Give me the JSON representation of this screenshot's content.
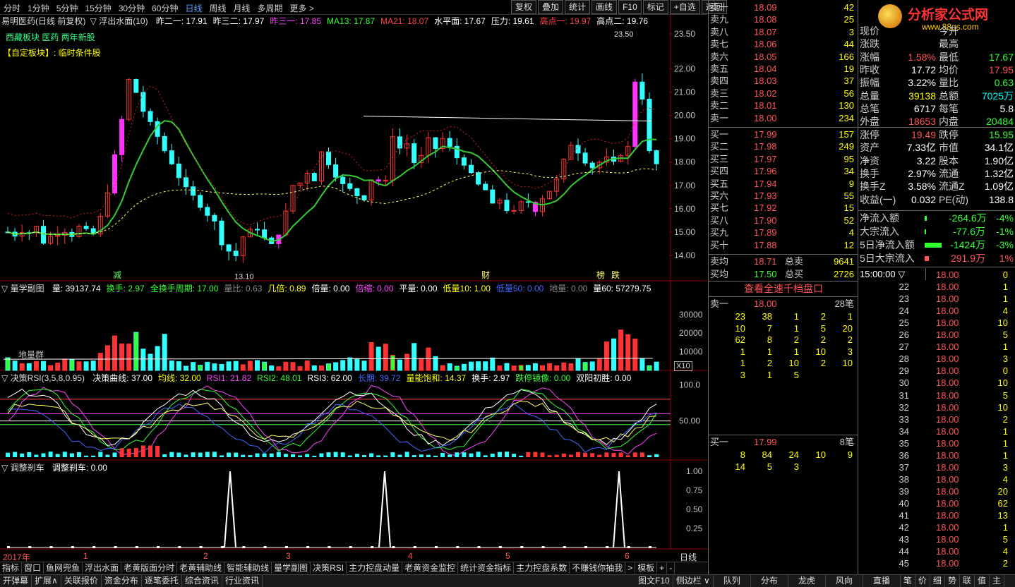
{
  "periods": [
    "分时",
    "1分钟",
    "5分钟",
    "15分钟",
    "30分钟",
    "60分钟",
    "日线",
    "周线",
    "月线",
    "多周期",
    "更多 >"
  ],
  "active_period": "日线",
  "toolbar": [
    "复权",
    "叠加",
    "统计",
    "画线",
    "F10",
    "标记",
    "+自选",
    "返回"
  ],
  "main_header": {
    "title": "易明医药(日线 前复权)",
    "indicator": "▽ 浮出水面(10)",
    "items": [
      {
        "text": "昨二一: 17.91",
        "color": "#ffffff"
      },
      {
        "text": "昨三二: 17.97",
        "color": "#ffffff"
      },
      {
        "text": "昨三一: 17.85",
        "color": "#ff44ff"
      },
      {
        "text": "MA13: 17.87",
        "color": "#33ff33"
      },
      {
        "text": "MA21: 18.07",
        "color": "#ff4444"
      },
      {
        "text": "水平面: 17.67",
        "color": "#ffffff"
      },
      {
        "text": "压力: 19.61",
        "color": "#ffffff"
      },
      {
        "text": "高点一: 19.97",
        "color": "#ff4444"
      },
      {
        "text": "高点二: 19.76",
        "color": "#ffffff"
      }
    ],
    "sector": "西藏板块  医药  两年新股",
    "custom": "【自定板块】: 临时条件股"
  },
  "price_axis": [
    "23.50",
    "22.00",
    "21.00",
    "20.00",
    "19.00",
    "18.00",
    "17.00",
    "16.00",
    "15.00",
    "14.00"
  ],
  "price_labels": {
    "high": "23.50",
    "low": "13.10"
  },
  "event_markers": [
    "减",
    "财",
    "榜",
    "跌"
  ],
  "volume_header": {
    "name": "▽ 量学副图",
    "items": [
      {
        "text": "量: 39137.74",
        "color": "#ffffff"
      },
      {
        "text": "换手: 2.97",
        "color": "#33ff33"
      },
      {
        "text": "全换手周期: 17.00",
        "color": "#33ff33"
      },
      {
        "text": "量比: 0.63",
        "color": "#888888"
      },
      {
        "text": "几倍: 0.89",
        "color": "#ffff00"
      },
      {
        "text": "倍量: 0.00",
        "color": "#ffffff"
      },
      {
        "text": "倍缩: 0.00",
        "color": "#ff44ff"
      },
      {
        "text": "平量: 0.00",
        "color": "#ffffff"
      },
      {
        "text": "低量10: 1.00",
        "color": "#ffff00"
      },
      {
        "text": "低量50: 0.00",
        "color": "#4466ff"
      },
      {
        "text": "地量: 0.00",
        "color": "#888888"
      },
      {
        "text": "量60: 57279.75",
        "color": "#ffffff"
      }
    ],
    "axis": [
      "30000",
      "20000",
      "10000"
    ],
    "tag": "地量群",
    "unit": "X10"
  },
  "rsi_header": {
    "name": "▽ 决策RSI(3,5,8,0.95)",
    "items": [
      {
        "text": "决策曲线: 37.00",
        "color": "#ffffff"
      },
      {
        "text": "均线: 32.00",
        "color": "#ffff00"
      },
      {
        "text": "RSI1: 21.82",
        "color": "#ff44ff"
      },
      {
        "text": "RSI2: 48.01",
        "color": "#33ff33"
      },
      {
        "text": "RSI3: 62.00",
        "color": "#ffffff"
      },
      {
        "text": "长期: 39.72",
        "color": "#4466ff"
      },
      {
        "text": "量能饱和: 14.37",
        "color": "#ffff00"
      },
      {
        "text": "换手: 2.97",
        "color": "#ffffff"
      },
      {
        "text": "跌停镜像: 0.00",
        "color": "#33ff33"
      },
      {
        "text": "双阳初胜: 0.00",
        "color": "#ffffff"
      }
    ],
    "axis": [
      "100.0",
      "50.00"
    ]
  },
  "adj_header": {
    "name": "▽ 调整刹车",
    "items": [
      {
        "text": "调整刹车: 0.00",
        "color": "#ffffff"
      }
    ],
    "axis": [
      "1.00",
      "0.75",
      "0.50",
      "0.25"
    ]
  },
  "date_axis": {
    "year": "2017年",
    "months": [
      "1",
      "2",
      "3",
      "4",
      "5",
      "6"
    ],
    "period_label": "日线"
  },
  "indicator_tabs": [
    "指标",
    "窗口",
    "鱼网兜鱼",
    "浮出水面",
    "老黄版面分时",
    "老黄辅助线",
    "智能辅助线",
    "量学副图",
    "决策RSI",
    "主力控盘动量",
    "老黄资金监控",
    "统计资金指标",
    "主力控盘系数",
    "不赚钱你抽我",
    ">",
    "模板",
    "+",
    "-"
  ],
  "bottom_tabs": [
    "开弹幕",
    "扩展∧",
    "关联报价",
    "资金分布",
    "逐笔委托",
    "综合资讯",
    "行业资讯"
  ],
  "bottom_right_tabs": [
    "图文F10",
    "侧边栏 ∨",
    "队列",
    "分布",
    "龙虎",
    "风向",
    "直播",
    "笔",
    "价",
    "细",
    "势",
    "联",
    "值",
    "主"
  ],
  "sell_orders": [
    {
      "label": "卖十",
      "price": "18.09",
      "vol": "42"
    },
    {
      "label": "卖九",
      "price": "18.08",
      "vol": "25"
    },
    {
      "label": "卖八",
      "price": "18.07",
      "vol": "3"
    },
    {
      "label": "卖七",
      "price": "18.06",
      "vol": "44"
    },
    {
      "label": "卖六",
      "price": "18.05",
      "vol": "166"
    },
    {
      "label": "卖五",
      "price": "18.04",
      "vol": "19"
    },
    {
      "label": "卖四",
      "price": "18.03",
      "vol": "37"
    },
    {
      "label": "卖三",
      "price": "18.02",
      "vol": "56"
    },
    {
      "label": "卖二",
      "price": "18.01",
      "vol": "130"
    },
    {
      "label": "卖一",
      "price": "18.00",
      "vol": "234"
    }
  ],
  "buy_orders": [
    {
      "label": "买一",
      "price": "17.99",
      "vol": "157"
    },
    {
      "label": "买二",
      "price": "17.98",
      "vol": "249"
    },
    {
      "label": "买三",
      "price": "17.97",
      "vol": "95"
    },
    {
      "label": "买四",
      "price": "17.96",
      "vol": "34"
    },
    {
      "label": "买五",
      "price": "17.94",
      "vol": "9"
    },
    {
      "label": "买六",
      "price": "17.93",
      "vol": "55"
    },
    {
      "label": "买七",
      "price": "17.92",
      "vol": "15"
    },
    {
      "label": "买八",
      "price": "17.90",
      "vol": "52"
    },
    {
      "label": "买九",
      "price": "17.89",
      "vol": "4"
    },
    {
      "label": "买十",
      "price": "17.88",
      "vol": "12"
    }
  ],
  "avg_rows": [
    {
      "label": "卖均",
      "price": "18.71",
      "label2": "总卖",
      "vol": "9641"
    },
    {
      "label": "买均",
      "price": "17.50",
      "label2": "总买",
      "vol": "2726"
    }
  ],
  "depth_title": "查看全速千档盘口",
  "depth_sell": {
    "label": "卖一",
    "price": "18.00",
    "count": "28笔",
    "rows": [
      [
        "23",
        "38",
        "1",
        "2",
        "1"
      ],
      [
        "10",
        "7",
        "1",
        "5",
        "20"
      ],
      [
        "62",
        "8",
        "2",
        "2",
        "2"
      ],
      [
        "1",
        "1",
        "1",
        "10",
        "3"
      ],
      [
        "1",
        "2",
        "10",
        "2",
        "10"
      ],
      [
        "3",
        "1",
        "5",
        "",
        ""
      ]
    ]
  },
  "depth_buy": {
    "label": "买一",
    "price": "17.99",
    "count": "8笔",
    "rows": [
      [
        "8",
        "84",
        "24",
        "10",
        "9"
      ],
      [
        "14",
        "5",
        "3",
        "",
        ""
      ]
    ]
  },
  "logo": {
    "text": "分析家公式网",
    "url": "www.88gs.com"
  },
  "stats": [
    {
      "l1": "现价",
      "v1": "",
      "l2": "今开",
      "v2": ""
    },
    {
      "l1": "涨跌",
      "v1": "",
      "l2": "最高",
      "v2": ""
    },
    {
      "l1": "涨幅",
      "v1": "1.58%",
      "c1": "#ff5555",
      "l2": "最低",
      "v2": "17.67",
      "c2": "#33ff33"
    },
    {
      "l1": "昨收",
      "v1": "17.72",
      "c1": "#ffffff",
      "l2": "均价",
      "v2": "17.95",
      "c2": "#ff5555"
    },
    {
      "l1": "振幅",
      "v1": "3.22%",
      "c1": "#ffffff",
      "l2": "量比",
      "v2": "0.63",
      "c2": "#33ff33"
    },
    {
      "l1": "总量",
      "v1": "39138",
      "c1": "#ffff00",
      "l2": "总额",
      "v2": "7025万",
      "c2": "#00ffff"
    },
    {
      "l1": "总笔",
      "v1": "6717",
      "c1": "#ffffff",
      "l2": "每笔",
      "v2": "5.8",
      "c2": "#ffffff"
    },
    {
      "l1": "外盘",
      "v1": "18653",
      "c1": "#ff5555",
      "l2": "内盘",
      "v2": "20484",
      "c2": "#33ff33"
    }
  ],
  "stats2": [
    {
      "l1": "涨停",
      "v1": "19.49",
      "c1": "#ff5555",
      "l2": "跌停",
      "v2": "15.95",
      "c2": "#33ff33"
    },
    {
      "l1": "资产",
      "v1": "7.33亿",
      "c1": "#ffffff",
      "l2": "市值",
      "v2": "34.1亿",
      "c2": "#ffffff"
    },
    {
      "l1": "净资",
      "v1": "3.22",
      "c1": "#ffffff",
      "l2": "股本",
      "v2": "1.90亿",
      "c2": "#ffffff"
    },
    {
      "l1": "换手",
      "v1": "2.97%",
      "c1": "#ffffff",
      "l2": "流通",
      "v2": "1.32亿",
      "c2": "#ffffff"
    },
    {
      "l1": "换手Z",
      "v1": "3.58%",
      "c1": "#ffffff",
      "l2": "流通Z",
      "v2": "1.09亿",
      "c2": "#ffffff"
    },
    {
      "l1": "收益(一)",
      "v1": "0.032",
      "c1": "#ffffff",
      "l2": "PE(动)",
      "v2": "138.8",
      "c2": "#ffffff"
    }
  ],
  "flows": [
    {
      "label": "净流入额",
      "value": "-264.6万",
      "pct": "-4%",
      "color": "#33ff33",
      "bar": 0.05
    },
    {
      "label": "大宗流入",
      "value": "-77.6万",
      "pct": "-1%",
      "color": "#33ff33",
      "bar": 0.01
    },
    {
      "label": "5日净流入额",
      "value": "-1424万",
      "pct": "-3%",
      "color": "#33ff33",
      "bar": 0.4
    },
    {
      "label": "5日大宗流入",
      "value": "291.9万",
      "pct": "1%",
      "color": "#ff5555",
      "bar": 0.1
    }
  ],
  "ticks_header": "15:00:00 ▽",
  "ticks": [
    {
      "n": "0",
      "p": "18.00",
      "v": "0"
    },
    {
      "n": "22",
      "p": "18.00",
      "v": "1"
    },
    {
      "n": "23",
      "p": "18.00",
      "v": "1"
    },
    {
      "n": "24",
      "p": "18.00",
      "v": "4"
    },
    {
      "n": "25",
      "p": "18.00",
      "v": "10"
    },
    {
      "n": "26",
      "p": "18.00",
      "v": "5"
    },
    {
      "n": "27",
      "p": "18.00",
      "v": "1"
    },
    {
      "n": "28",
      "p": "18.00",
      "v": "3"
    },
    {
      "n": "29",
      "p": "18.00",
      "v": "0"
    },
    {
      "n": "30",
      "p": "18.00",
      "v": "10"
    },
    {
      "n": "31",
      "p": "18.00",
      "v": "5"
    },
    {
      "n": "32",
      "p": "18.00",
      "v": "10"
    },
    {
      "n": "33",
      "p": "18.00",
      "v": "2"
    },
    {
      "n": "34",
      "p": "18.00",
      "v": "1"
    },
    {
      "n": "35",
      "p": "18.00",
      "v": "1"
    },
    {
      "n": "36",
      "p": "18.00",
      "v": "1"
    },
    {
      "n": "37",
      "p": "18.00",
      "v": "3"
    },
    {
      "n": "38",
      "p": "18.00",
      "v": "4"
    },
    {
      "n": "39",
      "p": "18.00",
      "v": "20"
    },
    {
      "n": "40",
      "p": "18.00",
      "v": "62"
    },
    {
      "n": "41",
      "p": "18.00",
      "v": "13"
    },
    {
      "n": "42",
      "p": "18.00",
      "v": "1"
    },
    {
      "n": "43",
      "p": "18.00",
      "v": "5"
    },
    {
      "n": "44",
      "p": "18.00",
      "v": "4"
    },
    {
      "n": "45",
      "p": "18.00",
      "v": "2"
    }
  ]
}
